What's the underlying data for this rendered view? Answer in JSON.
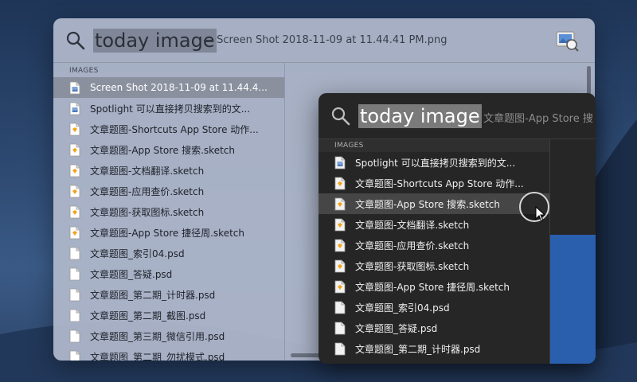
{
  "back_window": {
    "query": "today image",
    "suffix": "— Screen Shot 2018-11-09 at 11.44.41 PM.png",
    "section_label": "IMAGES",
    "preview_icon": "preview-app-icon",
    "items": [
      {
        "label": "Screen Shot 2018-11-09 at 11.44.4...",
        "icon": "image-file-icon",
        "selected": true
      },
      {
        "label": "Spotlight 可以直接拷贝搜索到的文...",
        "icon": "image-file-icon"
      },
      {
        "label": "文章题图-Shortcuts App Store 动作...",
        "icon": "sketch-file-icon"
      },
      {
        "label": "文章题图-App Store 搜索.sketch",
        "icon": "sketch-file-icon"
      },
      {
        "label": "文章题图-文档翻译.sketch",
        "icon": "sketch-file-icon"
      },
      {
        "label": "文章题图-应用查价.sketch",
        "icon": "sketch-file-icon"
      },
      {
        "label": "文章题图-获取图标.sketch",
        "icon": "sketch-file-icon"
      },
      {
        "label": "文章题图-App Store 捷径周.sketch",
        "icon": "sketch-file-icon"
      },
      {
        "label": "文章题图_索引04.psd",
        "icon": "document-icon"
      },
      {
        "label": "文章题图_答疑.psd",
        "icon": "document-icon"
      },
      {
        "label": "文章题图_第二期_计时器.psd",
        "icon": "document-icon"
      },
      {
        "label": "文章题图_第二期_截图.psd",
        "icon": "document-icon"
      },
      {
        "label": "文章题图_第三期_微信引用.psd",
        "icon": "document-icon"
      },
      {
        "label": "文章题图_第二期_勿扰模式.psd",
        "icon": "document-icon"
      }
    ]
  },
  "front_window": {
    "query": "today image",
    "suffix": "— 文章题图-App Store 搜",
    "section_label": "IMAGES",
    "items": [
      {
        "label": "Spotlight 可以直接拷贝搜索到的文...",
        "icon": "image-file-icon"
      },
      {
        "label": "文章题图-Shortcuts App Store 动作...",
        "icon": "sketch-file-icon"
      },
      {
        "label": "文章题图-App Store 搜索.sketch",
        "icon": "sketch-file-icon",
        "selected": true
      },
      {
        "label": "文章题图-文档翻译.sketch",
        "icon": "sketch-file-icon"
      },
      {
        "label": "文章题图-应用查价.sketch",
        "icon": "sketch-file-icon"
      },
      {
        "label": "文章题图-获取图标.sketch",
        "icon": "sketch-file-icon"
      },
      {
        "label": "文章题图-App Store 捷径周.sketch",
        "icon": "sketch-file-icon"
      },
      {
        "label": "文章题图_索引04.psd",
        "icon": "document-icon"
      },
      {
        "label": "文章题图_答疑.psd",
        "icon": "document-icon"
      },
      {
        "label": "文章题图_第二期_计时器.psd",
        "icon": "document-icon"
      }
    ]
  },
  "colors": {
    "desktop_bg": "#2e4a72",
    "selection_light": "#8a909e",
    "selection_dark": "#464646",
    "preview_blue": "#2a5fae",
    "sketch_orange": "#f4a31c"
  }
}
